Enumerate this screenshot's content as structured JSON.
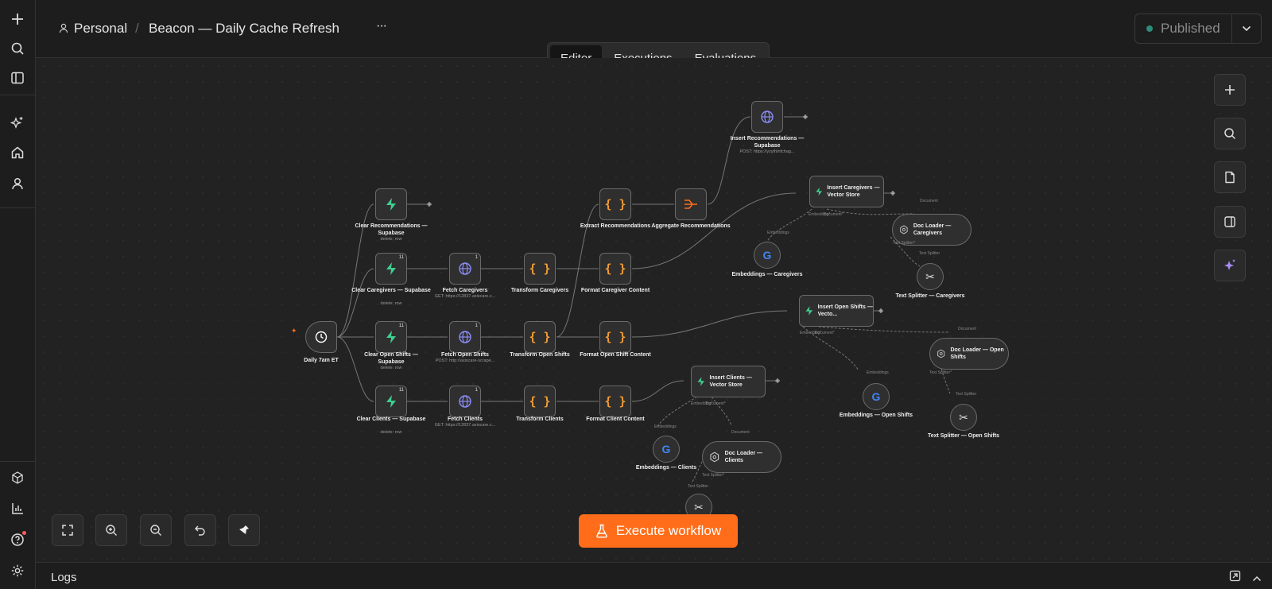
{
  "header": {
    "workspace": "Personal",
    "separator": "/",
    "workflow_name": "Beacon — Daily Cache Refresh",
    "more": "···",
    "status": "Published",
    "status_color": "#2e8a79"
  },
  "tabs": [
    {
      "label": "Editor",
      "active": true
    },
    {
      "label": "Executions",
      "active": false
    },
    {
      "label": "Evaluations",
      "active": false
    }
  ],
  "nodes": {
    "trigger": {
      "label": "Daily 7am ET"
    },
    "clear_recs": {
      "label": "Clear Recommendations — Supabase",
      "sub": "delete: row"
    },
    "clear_caregivers": {
      "label": "Clear Caregivers — Supabase",
      "sub": "delete: row",
      "badge": "11"
    },
    "clear_shifts": {
      "label": "Clear Open Shifts — Supabase",
      "sub": "delete: row",
      "badge": "11"
    },
    "clear_clients": {
      "label": "Clear Clients — Supabase",
      "sub": "delete: row",
      "badge": "11"
    },
    "fetch_caregivers": {
      "label": "Fetch Caregivers",
      "sub": "GET: https://12837.axiscare.c...",
      "badge": "1"
    },
    "fetch_shifts": {
      "label": "Fetch Open Shifts",
      "sub": "POST: http://axiscare-scrape...",
      "badge": "1"
    },
    "fetch_clients": {
      "label": "Fetch Clients",
      "sub": "GET: https://12837.axiscare.c...",
      "badge": "1"
    },
    "transform_caregivers": {
      "label": "Transform Caregivers"
    },
    "transform_shifts": {
      "label": "Transform Open Shifts"
    },
    "transform_clients": {
      "label": "Transform Clients"
    },
    "extract_recs": {
      "label": "Extract Recommendations"
    },
    "format_caregiver": {
      "label": "Format Caregiver Content"
    },
    "format_shift": {
      "label": "Format Open Shift Content"
    },
    "format_client": {
      "label": "Format Client Content"
    },
    "aggregate_recs": {
      "label": "Aggregate Recommendations"
    },
    "insert_recs": {
      "label": "Insert Recommendations — Supabase",
      "sub": "POST: https://yzythlnfchag..."
    },
    "insert_caregivers": {
      "label": "Insert Caregivers — Vector Store"
    },
    "insert_shifts": {
      "label": "Insert Open Shifts — Vecto..."
    },
    "insert_clients": {
      "label": "Insert Clients — Vector Store"
    },
    "doc_caregivers": {
      "label": "Doc Loader — Caregivers"
    },
    "doc_shifts": {
      "label": "Doc Loader — Open Shifts"
    },
    "doc_clients": {
      "label": "Doc Loader — Clients"
    },
    "emb_caregivers": {
      "label": "Embeddings — Caregivers"
    },
    "emb_shifts": {
      "label": "Embeddings — Open Shifts"
    },
    "emb_clients": {
      "label": "Embeddings — Clients"
    },
    "split_caregivers": {
      "label": "Text Splitter — Caregivers"
    },
    "split_shifts": {
      "label": "Text Splitter — Open Shifts"
    }
  },
  "ports": {
    "embedding": "Embedding*",
    "document": "Document*",
    "document_plain": "Document",
    "embeddings": "Embeddings",
    "text_splitter_req": "Text Splitter*",
    "text_splitter": "Text Splitter"
  },
  "actions": {
    "execute": "Execute workflow"
  },
  "logs": {
    "title": "Logs"
  },
  "colors": {
    "supabase_green": "#3ecf8e",
    "http_blue": "#8b8cf5",
    "code_orange": "#f29b34",
    "aggregate_orange": "#ff6d1a",
    "execute_orange": "#ff6d1a",
    "ai_purple": "#a78bfa"
  }
}
